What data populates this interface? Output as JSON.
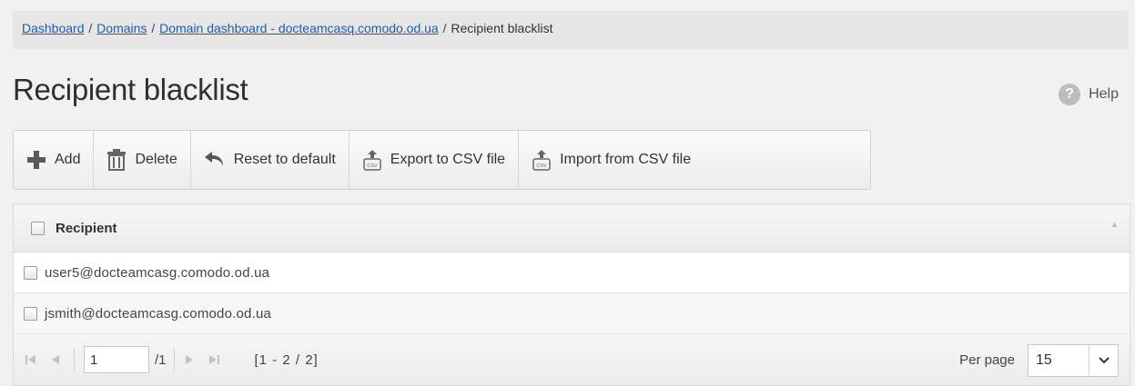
{
  "breadcrumb": {
    "items": [
      {
        "label": "Dashboard",
        "link": true
      },
      {
        "label": "Domains",
        "link": true
      },
      {
        "label": "Domain dashboard - docteamcasq.comodo.od.ua",
        "link": true
      },
      {
        "label": "Recipient blacklist",
        "link": false
      }
    ],
    "separator": "/"
  },
  "page": {
    "title": "Recipient blacklist",
    "help_label": "Help",
    "help_icon": "question-circle-icon"
  },
  "toolbar": {
    "add_label": "Add",
    "delete_label": "Delete",
    "reset_label": "Reset to default",
    "export_label": "Export to CSV file",
    "import_label": "Import from CSV file"
  },
  "grid": {
    "column_header": "Recipient",
    "rows": [
      {
        "recipient": "user5@docteamcasg.comodo.od.ua"
      },
      {
        "recipient": "jsmith@docteamcasg.comodo.od.ua"
      }
    ]
  },
  "pager": {
    "current_page": "1",
    "total_pages": "/1",
    "range": "[1 - 2 / 2]",
    "per_page_label": "Per page",
    "per_page_value": "15"
  },
  "colors": {
    "link": "#1a5fb4",
    "add_icon": "#5a5a5a",
    "background": "#f1f1f1"
  }
}
